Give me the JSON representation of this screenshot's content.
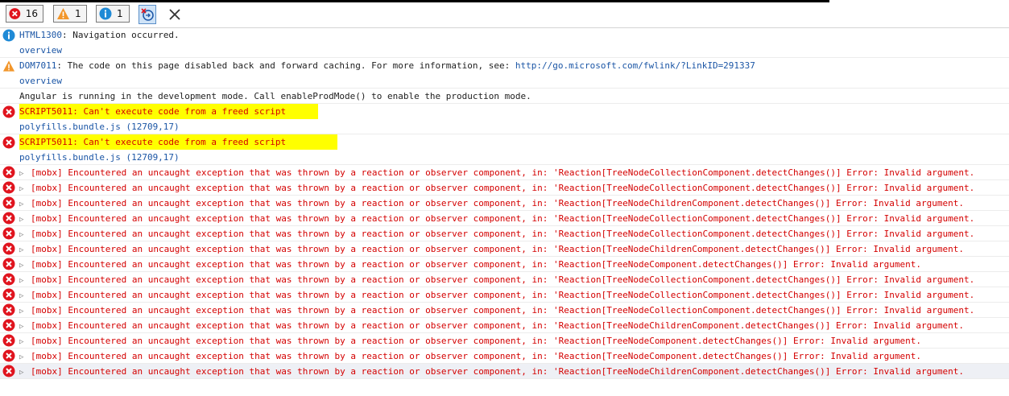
{
  "toolbar": {
    "errors_count": "16",
    "warnings_count": "1",
    "info_count": "1",
    "clear_on_nav_icon": "clear-on-navigate-icon",
    "close_icon": "close-icon"
  },
  "messages": {
    "info": {
      "code": "HTML1300",
      "text": ": Navigation occurred.",
      "link": "overview"
    },
    "warning": {
      "code": "DOM7011",
      "text": ": The code on this page disabled back and forward caching. For more information, see: ",
      "url": "http://go.microsoft.com/fwlink/?LinkID=291337",
      "link": "overview"
    },
    "log": {
      "text": "Angular is running in the development mode. Call enableProdMode() to enable the production mode."
    },
    "script_errors": [
      {
        "text": "SCRIPT5011: Can't execute code from a freed script",
        "source": "polyfills.bundle.js (12709,17)"
      },
      {
        "text": "SCRIPT5011: Can't execute code from a freed script",
        "source": "polyfills.bundle.js (12709,17)"
      }
    ],
    "mobx_errors": [
      "[mobx] Encountered an uncaught exception that was thrown by a reaction or observer component, in: 'Reaction[TreeNodeCollectionComponent.detectChanges()] Error: Invalid argument.",
      "[mobx] Encountered an uncaught exception that was thrown by a reaction or observer component, in: 'Reaction[TreeNodeCollectionComponent.detectChanges()] Error: Invalid argument.",
      "[mobx] Encountered an uncaught exception that was thrown by a reaction or observer component, in: 'Reaction[TreeNodeChildrenComponent.detectChanges()] Error: Invalid argument.",
      "[mobx] Encountered an uncaught exception that was thrown by a reaction or observer component, in: 'Reaction[TreeNodeCollectionComponent.detectChanges()] Error: Invalid argument.",
      "[mobx] Encountered an uncaught exception that was thrown by a reaction or observer component, in: 'Reaction[TreeNodeCollectionComponent.detectChanges()] Error: Invalid argument.",
      "[mobx] Encountered an uncaught exception that was thrown by a reaction or observer component, in: 'Reaction[TreeNodeChildrenComponent.detectChanges()] Error: Invalid argument.",
      "[mobx] Encountered an uncaught exception that was thrown by a reaction or observer component, in: 'Reaction[TreeNodeComponent.detectChanges()] Error: Invalid argument.",
      "[mobx] Encountered an uncaught exception that was thrown by a reaction or observer component, in: 'Reaction[TreeNodeCollectionComponent.detectChanges()] Error: Invalid argument.",
      "[mobx] Encountered an uncaught exception that was thrown by a reaction or observer component, in: 'Reaction[TreeNodeCollectionComponent.detectChanges()] Error: Invalid argument.",
      "[mobx] Encountered an uncaught exception that was thrown by a reaction or observer component, in: 'Reaction[TreeNodeCollectionComponent.detectChanges()] Error: Invalid argument.",
      "[mobx] Encountered an uncaught exception that was thrown by a reaction or observer component, in: 'Reaction[TreeNodeChildrenComponent.detectChanges()] Error: Invalid argument.",
      "[mobx] Encountered an uncaught exception that was thrown by a reaction or observer component, in: 'Reaction[TreeNodeComponent.detectChanges()] Error: Invalid argument.",
      "[mobx] Encountered an uncaught exception that was thrown by a reaction or observer component, in: 'Reaction[TreeNodeComponent.detectChanges()] Error: Invalid argument.",
      "[mobx] Encountered an uncaught exception that was thrown by a reaction or observer component, in: 'Reaction[TreeNodeChildrenComponent.detectChanges()] Error: Invalid argument."
    ]
  },
  "colors": {
    "error_red": "#d40000",
    "link_blue": "#1a55a5",
    "info_blue": "#1f8ad6",
    "warning_orange": "#f2962b",
    "highlight_yellow": "#ffff00"
  }
}
